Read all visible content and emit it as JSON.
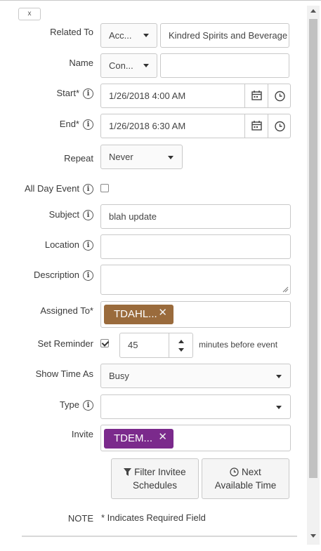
{
  "close_label": "x",
  "fields": {
    "related_to": {
      "label": "Related To",
      "object_type": "Acc...",
      "value": "Kindred Spirits and Beverage"
    },
    "name": {
      "label": "Name",
      "object_type": "Con...",
      "value": ""
    },
    "start": {
      "label": "Start*",
      "value": "1/26/2018 4:00 AM"
    },
    "end": {
      "label": "End*",
      "value": "1/26/2018 6:30 AM"
    },
    "repeat": {
      "label": "Repeat",
      "value": "Never"
    },
    "all_day": {
      "label": "All Day Event",
      "checked": false
    },
    "subject": {
      "label": "Subject",
      "value": "blah update"
    },
    "location": {
      "label": "Location",
      "value": ""
    },
    "description": {
      "label": "Description",
      "value": ""
    },
    "assigned_to": {
      "label": "Assigned To*",
      "chip": "TDAHL...",
      "chip_color": "#9a6b3c"
    },
    "reminder": {
      "label": "Set Reminder",
      "checked": true,
      "minutes": "45",
      "suffix": "minutes before event"
    },
    "show_time_as": {
      "label": "Show Time As",
      "value": "Busy"
    },
    "type": {
      "label": "Type",
      "value": ""
    },
    "invite": {
      "label": "Invite",
      "chip": "TDEM...",
      "chip_color": "#7b2a8c"
    }
  },
  "buttons": {
    "filter_line1": "Filter Invitee",
    "filter_line2": "Schedules",
    "next_line1": "Next",
    "next_line2": "Available Time"
  },
  "note": {
    "label": "NOTE",
    "text": "* Indicates Required Field"
  },
  "icons": [
    "close-icon",
    "info-icon",
    "calendar-icon",
    "clock-icon",
    "chevron-down-icon",
    "remove-icon",
    "filter-icon",
    "spinner-up-icon",
    "spinner-down-icon",
    "checkmark-icon"
  ]
}
